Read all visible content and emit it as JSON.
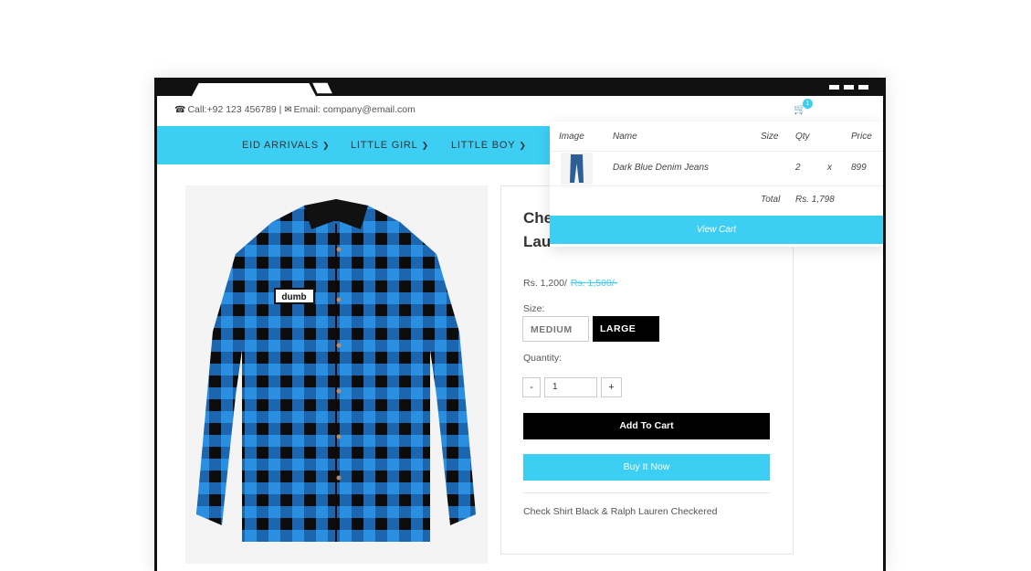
{
  "topbar": {
    "phone": "Call:+92 123 456789 |",
    "email": "Email: company@email.com",
    "cart_count": "1"
  },
  "icons": {
    "phone": "phone-icon",
    "email": "envelope-icon",
    "cart": "cart-icon",
    "chevron": "chevron-down-icon"
  },
  "nav": {
    "items": [
      {
        "label": "EID ARRIVALS"
      },
      {
        "label": "LITTLE GIRL"
      },
      {
        "label": "LITTLE BOY"
      }
    ]
  },
  "product": {
    "title_line1": "Che",
    "title_line2": "Lau",
    "price": "Rs. 1,200/",
    "old_price": "Rs. 1,500/-",
    "size_label": "Size:",
    "sizes": [
      {
        "label": "MEDIUM",
        "selected": false
      },
      {
        "label": "LARGE",
        "selected": true
      }
    ],
    "quantity_label": "Quantity:",
    "quantity_minus": "-",
    "quantity_value": "1",
    "quantity_plus": "+",
    "add_to_cart": "Add To Cart",
    "buy_now": "Buy It Now",
    "description": "Check Shirt Black & Ralph Lauren Checkered"
  },
  "cart_dropdown": {
    "headers": {
      "image": "Image",
      "name": "Name",
      "size": "Size",
      "qty": "Qty",
      "price": "Price"
    },
    "items": [
      {
        "name": "Dark Blue Denim Jeans",
        "size": "",
        "qty": "2",
        "x": "x",
        "price": "899"
      }
    ],
    "total_label": "Total",
    "total_value": "Rs. 1,798",
    "view_cart": "View Cart"
  },
  "colors": {
    "accent": "#3dcef4",
    "dark": "#000000"
  }
}
